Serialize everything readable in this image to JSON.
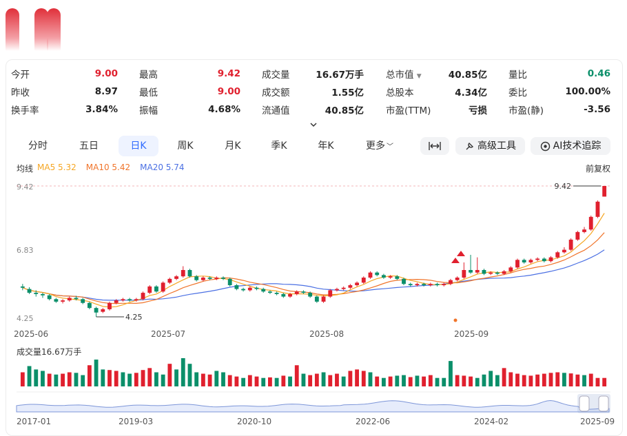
{
  "colors": {
    "up": "#e0202e",
    "down": "#0b8f6a",
    "ma5": "#f5a623",
    "ma10": "#f0742a",
    "ma20": "#4a6fe3",
    "accent": "#2f6bff"
  },
  "stats": [
    {
      "label": "今开",
      "value": "9.00",
      "color": "red"
    },
    {
      "label": "最高",
      "value": "9.42",
      "color": "red"
    },
    {
      "label": "成交量",
      "value": "16.67万手",
      "color": "black"
    },
    {
      "label": "总市值",
      "value": "40.85亿",
      "color": "black"
    },
    {
      "label": "量比",
      "value": "0.46",
      "color": "green"
    },
    {
      "label": "昨收",
      "value": "8.97",
      "color": "black"
    },
    {
      "label": "最低",
      "value": "9.00",
      "color": "red"
    },
    {
      "label": "成交额",
      "value": "1.55亿",
      "color": "black"
    },
    {
      "label": "总股本",
      "value": "4.34亿",
      "color": "black"
    },
    {
      "label": "委比",
      "value": "100.00%",
      "color": "black"
    },
    {
      "label": "换手率",
      "value": "3.84%",
      "color": "black"
    },
    {
      "label": "振幅",
      "value": "4.68%",
      "color": "black"
    },
    {
      "label": "流通值",
      "value": "40.85亿",
      "color": "black"
    },
    {
      "label": "市盈(TTM)",
      "value": "亏损",
      "color": "black"
    },
    {
      "label": "市盈(静)",
      "value": "-3.56",
      "color": "black"
    }
  ],
  "tabs": [
    "分时",
    "五日",
    "日K",
    "周K",
    "月K",
    "季K",
    "年K",
    "更多"
  ],
  "active_tab": "日K",
  "tools": {
    "fit_icon": "expand-width-icon",
    "advanced": "高级工具",
    "ai": "AI技术追踪"
  },
  "ma": {
    "title": "均线",
    "ma5": "MA5 5.32",
    "ma10": "MA10 5.42",
    "ma20": "MA20 5.74"
  },
  "adjust": "前复权",
  "price_axis": {
    "top": "9.42",
    "mid": "6.83",
    "bottom": "4.25"
  },
  "markers": {
    "high": "9.42",
    "low": "4.25"
  },
  "dates": [
    "2025-06",
    "2025-07",
    "2025-08",
    "2025-09"
  ],
  "volume_title": "成交量16.67万手",
  "overview_dates": [
    "2017-01",
    "2019-03",
    "2020-10",
    "2022-06",
    "2024-02",
    "2025-09"
  ],
  "chart_data": {
    "type": "candlestick",
    "ylim": [
      4.25,
      9.42
    ],
    "candles": [
      [
        5.45,
        5.4,
        5.55,
        5.3
      ],
      [
        5.35,
        5.2,
        5.42,
        5.15
      ],
      [
        5.2,
        5.15,
        5.3,
        5.05
      ],
      [
        5.15,
        5.1,
        5.2,
        5.0
      ],
      [
        5.1,
        4.95,
        5.15,
        4.9
      ],
      [
        4.95,
        4.85,
        5.0,
        4.8
      ],
      [
        4.85,
        4.9,
        4.95,
        4.78
      ],
      [
        4.9,
        5.0,
        5.05,
        4.85
      ],
      [
        5.0,
        4.95,
        5.08,
        4.9
      ],
      [
        4.95,
        4.8,
        5.0,
        4.75
      ],
      [
        4.8,
        4.6,
        4.85,
        4.55
      ],
      [
        4.6,
        4.42,
        4.65,
        4.25
      ],
      [
        4.45,
        4.55,
        4.6,
        4.4
      ],
      [
        4.55,
        4.8,
        4.85,
        4.5
      ],
      [
        4.8,
        4.9,
        4.95,
        4.75
      ],
      [
        4.9,
        4.95,
        5.0,
        4.85
      ],
      [
        4.95,
        4.9,
        5.0,
        4.85
      ],
      [
        4.9,
        4.95,
        5.0,
        4.85
      ],
      [
        4.95,
        5.2,
        5.25,
        4.9
      ],
      [
        5.2,
        5.45,
        5.5,
        5.15
      ],
      [
        5.45,
        5.25,
        5.5,
        5.2
      ],
      [
        5.25,
        5.6,
        5.65,
        5.2
      ],
      [
        5.6,
        5.75,
        5.8,
        5.55
      ],
      [
        5.75,
        5.85,
        5.9,
        5.7
      ],
      [
        5.85,
        6.1,
        6.25,
        5.8
      ],
      [
        6.1,
        5.85,
        6.15,
        5.8
      ],
      [
        5.85,
        5.7,
        5.9,
        5.65
      ],
      [
        5.7,
        5.8,
        5.85,
        5.65
      ],
      [
        5.8,
        5.75,
        5.85,
        5.7
      ],
      [
        5.75,
        5.8,
        5.85,
        5.7
      ],
      [
        5.8,
        5.75,
        5.85,
        5.7
      ],
      [
        5.75,
        5.5,
        5.8,
        5.45
      ],
      [
        5.5,
        5.35,
        5.55,
        5.3
      ],
      [
        5.35,
        5.3,
        5.4,
        5.25
      ],
      [
        5.3,
        5.4,
        5.45,
        5.25
      ],
      [
        5.4,
        5.35,
        5.45,
        5.3
      ],
      [
        5.35,
        5.25,
        5.4,
        5.2
      ],
      [
        5.25,
        5.2,
        5.3,
        5.15
      ],
      [
        5.2,
        5.15,
        5.25,
        5.1
      ],
      [
        5.15,
        5.05,
        5.2,
        5.0
      ],
      [
        5.05,
        5.15,
        5.2,
        5.0
      ],
      [
        5.15,
        5.25,
        5.3,
        5.1
      ],
      [
        5.25,
        5.2,
        5.3,
        5.15
      ],
      [
        5.2,
        5.05,
        5.25,
        5.0
      ],
      [
        5.05,
        4.85,
        5.1,
        4.8
      ],
      [
        4.85,
        5.05,
        5.1,
        4.8
      ],
      [
        5.05,
        5.3,
        5.35,
        5.0
      ],
      [
        5.3,
        5.35,
        5.4,
        5.25
      ],
      [
        5.35,
        5.4,
        5.45,
        5.3
      ],
      [
        5.4,
        5.5,
        5.55,
        5.35
      ],
      [
        5.5,
        5.6,
        5.65,
        5.45
      ],
      [
        5.6,
        5.8,
        5.85,
        5.55
      ],
      [
        5.8,
        6.0,
        6.05,
        5.75
      ],
      [
        6.0,
        5.9,
        6.05,
        5.85
      ],
      [
        5.9,
        5.8,
        5.95,
        5.75
      ],
      [
        5.8,
        5.85,
        5.9,
        5.75
      ],
      [
        5.85,
        5.75,
        5.9,
        5.7
      ],
      [
        5.75,
        5.55,
        5.8,
        5.5
      ],
      [
        5.55,
        5.5,
        5.6,
        5.45
      ],
      [
        5.5,
        5.55,
        5.6,
        5.45
      ],
      [
        5.55,
        5.5,
        5.6,
        5.45
      ],
      [
        5.5,
        5.55,
        5.6,
        5.45
      ],
      [
        5.55,
        5.5,
        5.6,
        5.45
      ],
      [
        5.5,
        5.55,
        5.6,
        5.45
      ],
      [
        5.55,
        5.7,
        5.75,
        5.5
      ],
      [
        5.7,
        5.8,
        5.85,
        5.65
      ],
      [
        5.8,
        6.1,
        6.4,
        5.75
      ],
      [
        6.1,
        6.0,
        6.7,
        5.95
      ],
      [
        6.0,
        6.1,
        6.6,
        5.95
      ],
      [
        6.1,
        5.95,
        6.15,
        5.9
      ],
      [
        5.95,
        6.0,
        6.05,
        5.9
      ],
      [
        6.0,
        5.95,
        6.05,
        5.9
      ],
      [
        5.95,
        6.05,
        6.1,
        5.9
      ],
      [
        6.05,
        6.2,
        6.25,
        6.0
      ],
      [
        6.2,
        6.5,
        6.55,
        6.15
      ],
      [
        6.5,
        6.4,
        6.55,
        6.35
      ],
      [
        6.4,
        6.5,
        6.55,
        6.35
      ],
      [
        6.5,
        6.55,
        6.6,
        6.45
      ],
      [
        6.55,
        6.45,
        6.6,
        6.4
      ],
      [
        6.45,
        6.6,
        6.65,
        6.4
      ],
      [
        6.6,
        6.8,
        6.85,
        6.55
      ],
      [
        6.8,
        6.9,
        7.0,
        6.75
      ],
      [
        6.9,
        7.3,
        7.35,
        6.85
      ],
      [
        7.3,
        7.6,
        7.65,
        7.25
      ],
      [
        7.6,
        7.7,
        7.8,
        7.55
      ],
      [
        7.7,
        8.2,
        8.25,
        7.65
      ],
      [
        8.2,
        8.8,
        8.85,
        8.15
      ],
      [
        9.0,
        9.42,
        9.42,
        9.0
      ]
    ],
    "volumes": [
      [
        1,
        0.5
      ],
      [
        0,
        0.72
      ],
      [
        0,
        0.6
      ],
      [
        0,
        0.55
      ],
      [
        1,
        0.45
      ],
      [
        0,
        0.42
      ],
      [
        1,
        0.45
      ],
      [
        1,
        0.5
      ],
      [
        0,
        0.48
      ],
      [
        0,
        0.4
      ],
      [
        1,
        0.75
      ],
      [
        0,
        0.95
      ],
      [
        0,
        0.6
      ],
      [
        1,
        0.58
      ],
      [
        1,
        0.55
      ],
      [
        0,
        0.5
      ],
      [
        0,
        0.45
      ],
      [
        1,
        0.48
      ],
      [
        1,
        0.58
      ],
      [
        1,
        0.65
      ],
      [
        0,
        0.5
      ],
      [
        0,
        0.42
      ],
      [
        1,
        0.8
      ],
      [
        0,
        0.6
      ],
      [
        0,
        1.0
      ],
      [
        0,
        0.8
      ],
      [
        0,
        0.5
      ],
      [
        1,
        0.45
      ],
      [
        1,
        0.42
      ],
      [
        0,
        0.55
      ],
      [
        0,
        0.5
      ],
      [
        1,
        0.4
      ],
      [
        1,
        0.35
      ],
      [
        0,
        0.3
      ],
      [
        1,
        0.4
      ],
      [
        1,
        0.35
      ],
      [
        0,
        0.3
      ],
      [
        1,
        0.32
      ],
      [
        0,
        0.3
      ],
      [
        1,
        0.38
      ],
      [
        0,
        0.35
      ],
      [
        1,
        0.75
      ],
      [
        0,
        0.45
      ],
      [
        1,
        0.4
      ],
      [
        1,
        0.45
      ],
      [
        0,
        0.5
      ],
      [
        1,
        0.4
      ],
      [
        1,
        0.45
      ],
      [
        0,
        0.35
      ],
      [
        1,
        0.55
      ],
      [
        1,
        0.6
      ],
      [
        1,
        0.55
      ],
      [
        0,
        0.5
      ],
      [
        1,
        0.35
      ],
      [
        0,
        0.3
      ],
      [
        1,
        0.35
      ],
      [
        0,
        0.38
      ],
      [
        0,
        0.4
      ],
      [
        1,
        0.33
      ],
      [
        0,
        0.38
      ],
      [
        1,
        0.35
      ],
      [
        1,
        0.4
      ],
      [
        0,
        0.3
      ],
      [
        0,
        0.3
      ],
      [
        0,
        0.9
      ],
      [
        1,
        0.4
      ],
      [
        1,
        0.38
      ],
      [
        1,
        0.35
      ],
      [
        0,
        0.3
      ],
      [
        0,
        0.42
      ],
      [
        0,
        0.55
      ],
      [
        0,
        0.4
      ],
      [
        1,
        0.65
      ],
      [
        1,
        0.5
      ],
      [
        1,
        0.45
      ],
      [
        1,
        0.4
      ],
      [
        1,
        0.38
      ],
      [
        1,
        0.42
      ],
      [
        1,
        0.45
      ],
      [
        1,
        0.48
      ],
      [
        1,
        0.5
      ],
      [
        0,
        0.48
      ],
      [
        1,
        0.46
      ],
      [
        1,
        0.42
      ],
      [
        0,
        0.4
      ],
      [
        1,
        0.45
      ],
      [
        1,
        0.3
      ],
      [
        1,
        0.3
      ]
    ],
    "dates_at_index": {
      "0": "2025-06",
      "21": "2025-07",
      "47": "2025-08",
      "73": "2025-09"
    }
  }
}
